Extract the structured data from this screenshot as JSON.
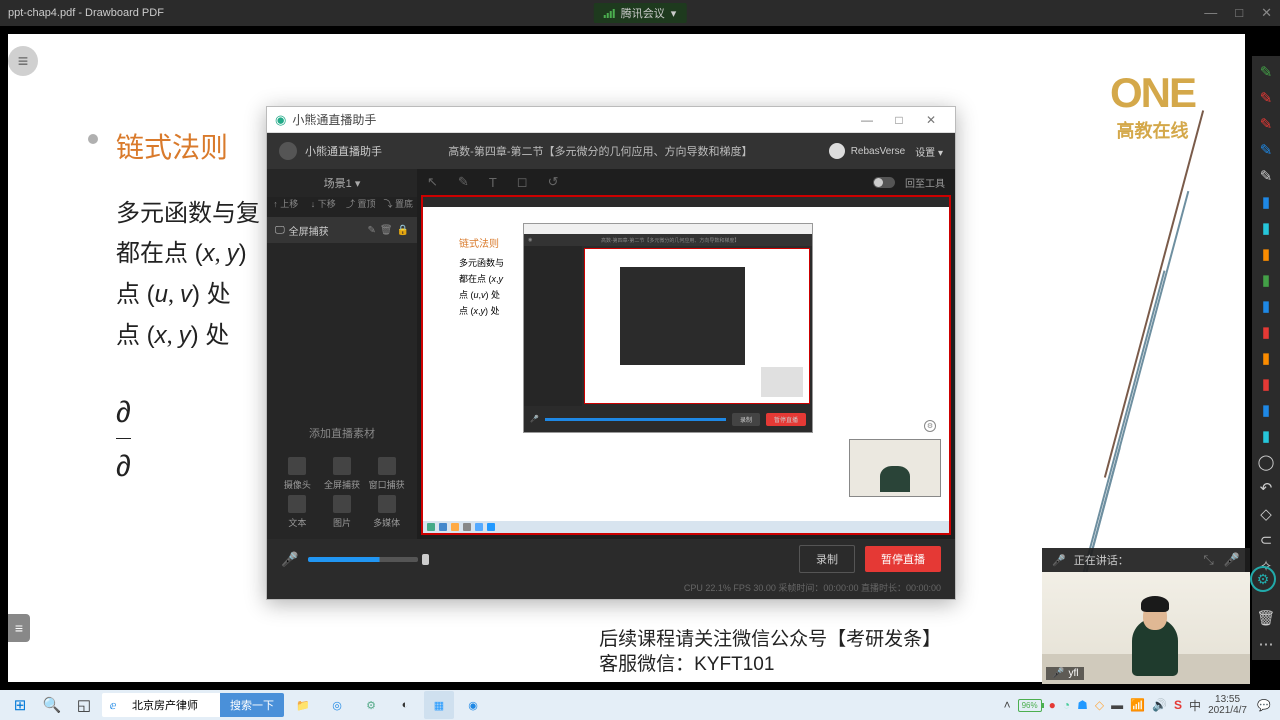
{
  "titlebar": {
    "title": "ppt-chap4.pdf - Drawboard PDF",
    "meeting": "腾讯会议"
  },
  "page": {
    "heading": "链式法则",
    "line1": "多元函数与复",
    "line2_a": "都在点 (",
    "line2_b": ") ",
    "line3_a": "点 (",
    "line3_b": ") 处",
    "line4_a": "点 (",
    "line4_b": ") 处",
    "logo_big": "ONE",
    "logo_sub": "高教在线",
    "foot1": "后续课程请关注微信公众号【考研发条】",
    "foot2": "客服微信：KYFT101"
  },
  "stream": {
    "title": "小熊通直播助手",
    "app_name": "小熊通直播助手",
    "course": "高数-第四章-第二节【多元微分的几何应用、方向导数和梯度】",
    "user": "RebasVerse",
    "settings": "设置 ▾",
    "scene": "场景1 ▾",
    "ops": {
      "up": "↑ 上移",
      "down": "↓ 下移",
      "top": "⤴ 置顶",
      "bottom": "⤵ 置底"
    },
    "source_item": "全屏捕获",
    "add_label": "添加直播素材",
    "sources": {
      "cam": "摄像头",
      "screen": "全屏捕获",
      "win": "窗口捕获",
      "text": "文本",
      "img": "图片",
      "media": "多媒体"
    },
    "drawtool": "回至工具",
    "record": "录制",
    "stop": "暂停直播",
    "status": "CPU  22.1%   FPS   30.00   采帧时间：00:00:00   直播时长：00:00:00"
  },
  "speaker": {
    "label": "正在讲话：",
    "name": "yfl"
  },
  "taskbar": {
    "search_value": "北京房产律师",
    "search_btn": "搜索一下",
    "battery": "96%",
    "time": "13:55",
    "date": "2021/4/7"
  }
}
